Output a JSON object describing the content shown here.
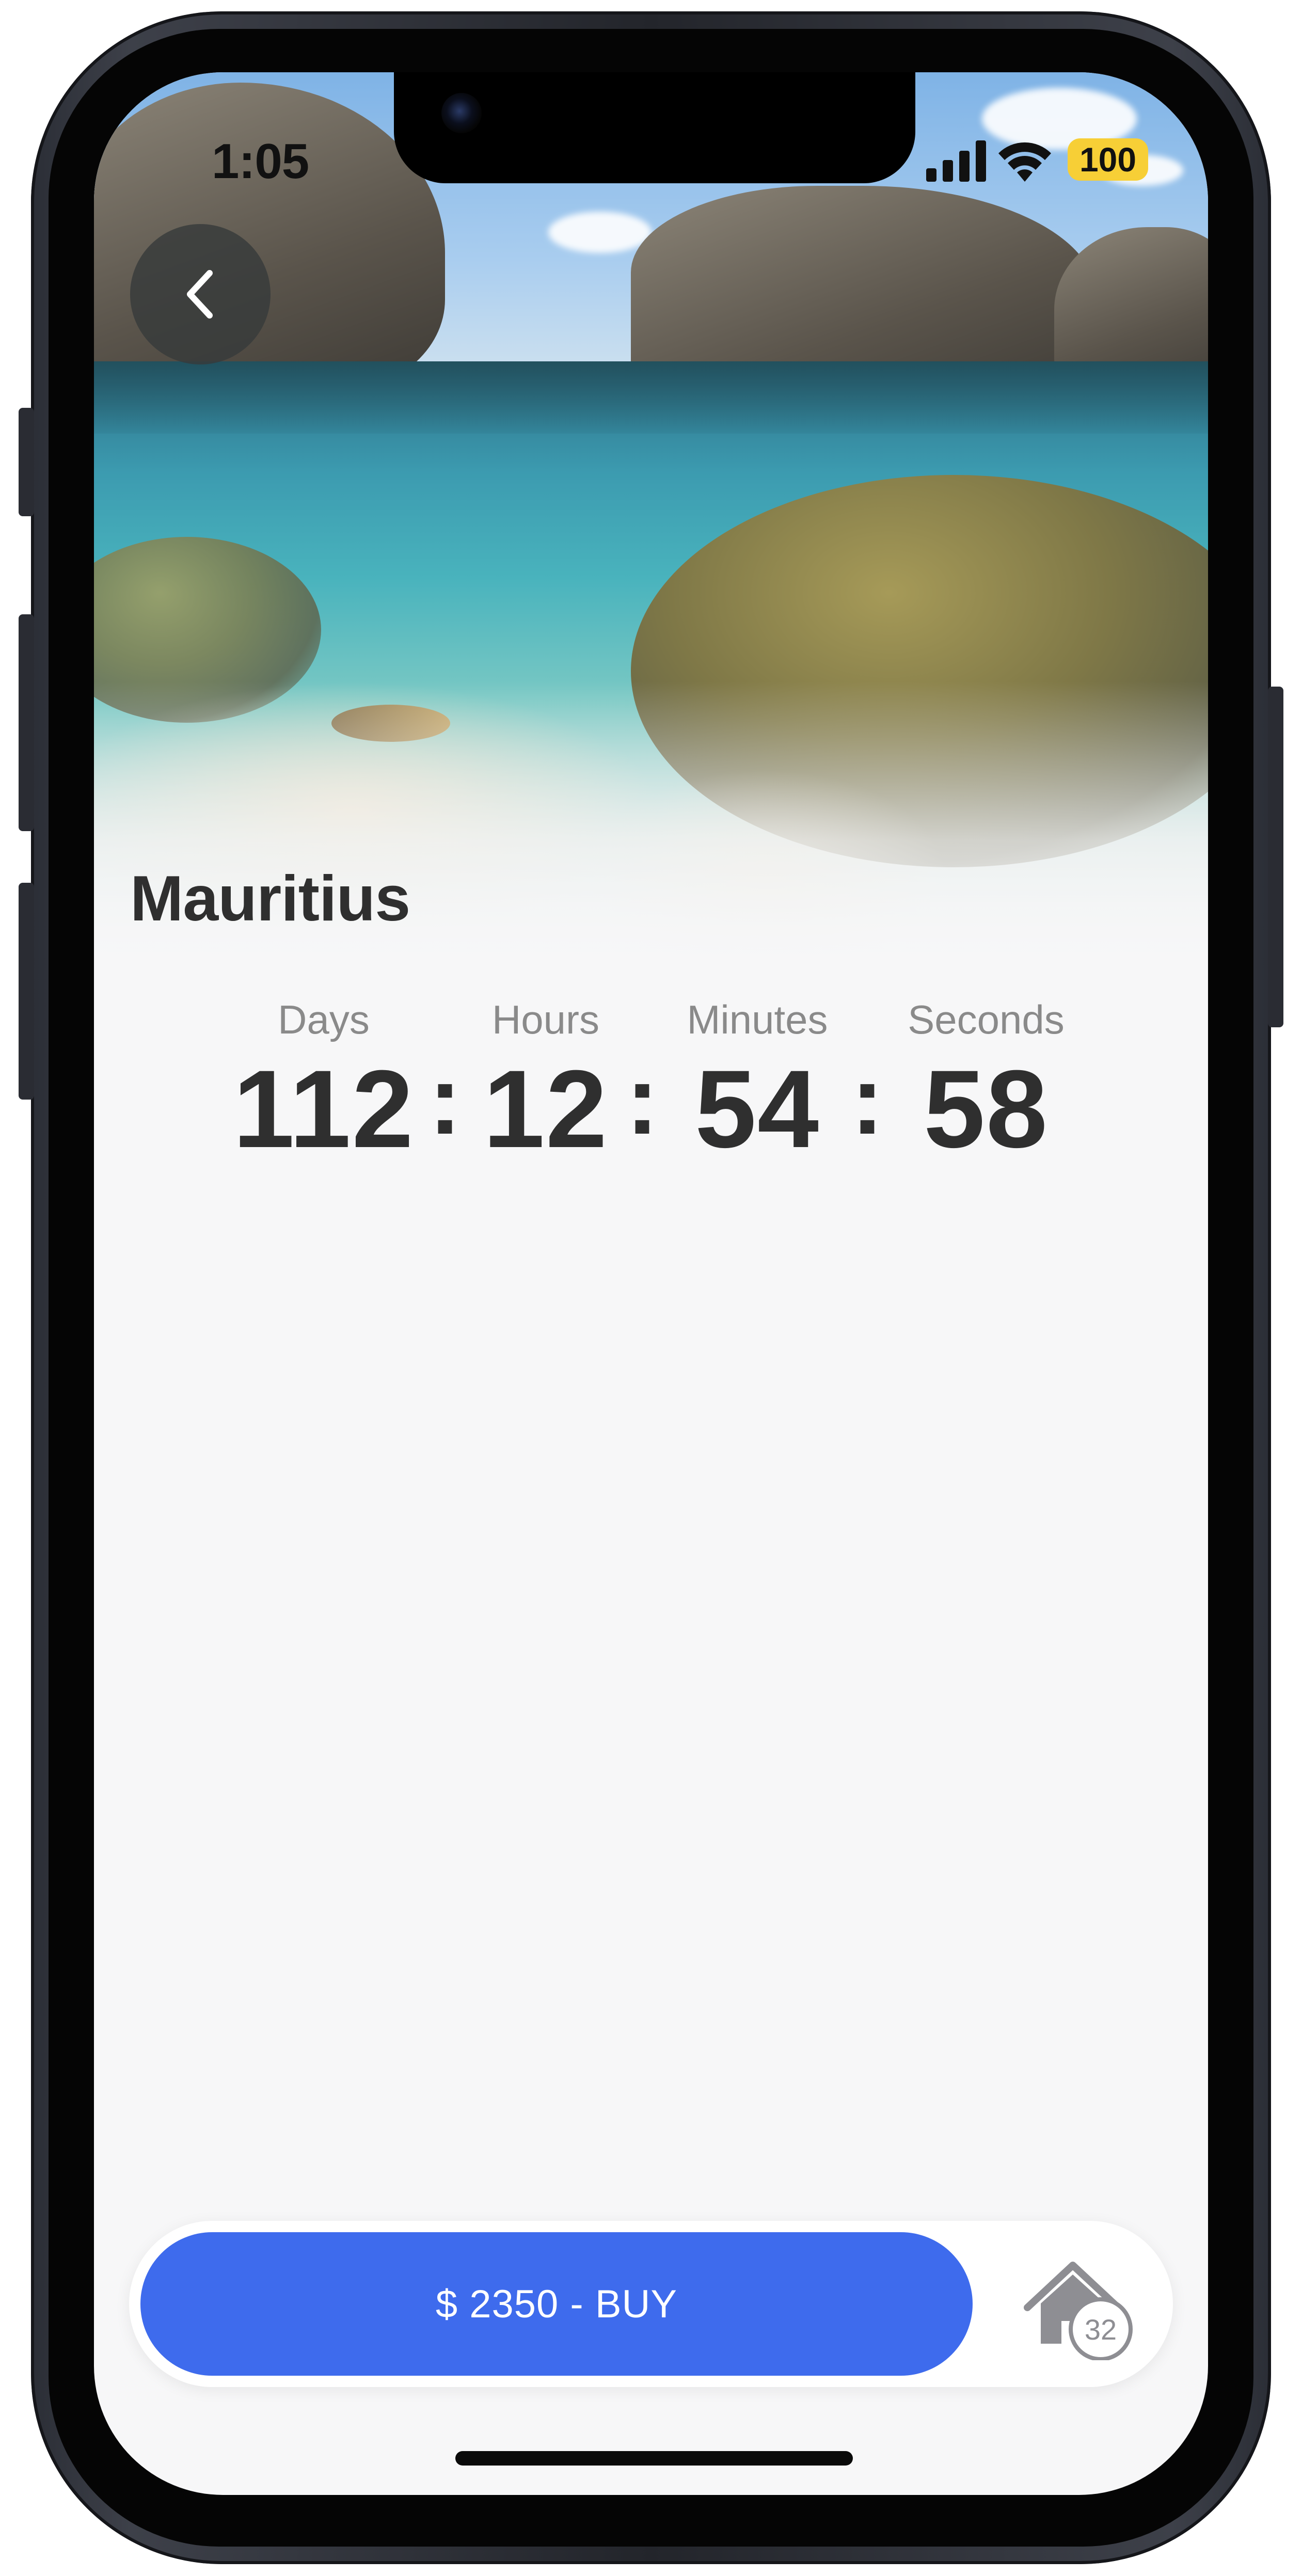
{
  "status_bar": {
    "time": "1:05",
    "battery": "100",
    "battery_color": "#f7cf36"
  },
  "navigation": {
    "back_icon": "chevron-left-icon"
  },
  "destination": {
    "title": "Mauritius",
    "hero_image": "underwater-reef-photo"
  },
  "countdown": {
    "labels": {
      "days": "Days",
      "hours": "Hours",
      "minutes": "Minutes",
      "seconds": "Seconds"
    },
    "values": {
      "days": "112",
      "hours": "12",
      "minutes": "54",
      "seconds": "58"
    },
    "separator": ":"
  },
  "purchase": {
    "buy_label": "$ 2350 - BUY",
    "buy_color": "#3e6bed",
    "house_icon": "house-icon",
    "house_count": "32"
  }
}
